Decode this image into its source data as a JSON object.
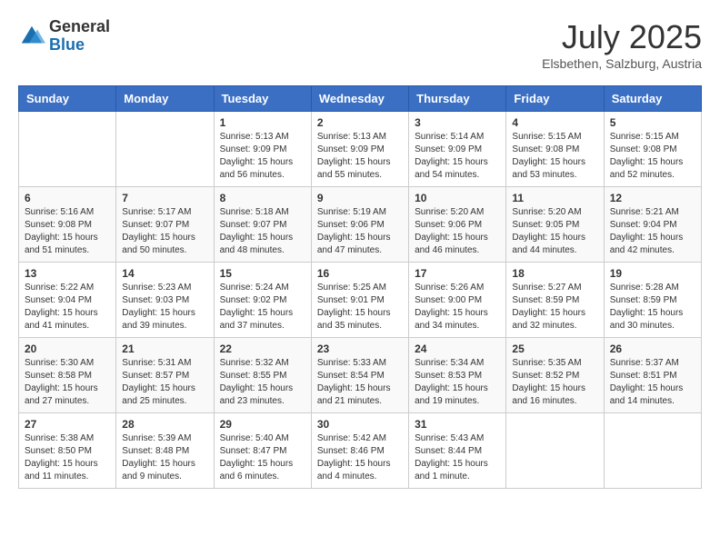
{
  "header": {
    "logo_general": "General",
    "logo_blue": "Blue",
    "month_title": "July 2025",
    "location": "Elsbethen, Salzburg, Austria"
  },
  "days_of_week": [
    "Sunday",
    "Monday",
    "Tuesday",
    "Wednesday",
    "Thursday",
    "Friday",
    "Saturday"
  ],
  "weeks": [
    [
      {
        "day": "",
        "sunrise": "",
        "sunset": "",
        "daylight": ""
      },
      {
        "day": "",
        "sunrise": "",
        "sunset": "",
        "daylight": ""
      },
      {
        "day": "1",
        "sunrise": "Sunrise: 5:13 AM",
        "sunset": "Sunset: 9:09 PM",
        "daylight": "Daylight: 15 hours and 56 minutes."
      },
      {
        "day": "2",
        "sunrise": "Sunrise: 5:13 AM",
        "sunset": "Sunset: 9:09 PM",
        "daylight": "Daylight: 15 hours and 55 minutes."
      },
      {
        "day": "3",
        "sunrise": "Sunrise: 5:14 AM",
        "sunset": "Sunset: 9:09 PM",
        "daylight": "Daylight: 15 hours and 54 minutes."
      },
      {
        "day": "4",
        "sunrise": "Sunrise: 5:15 AM",
        "sunset": "Sunset: 9:08 PM",
        "daylight": "Daylight: 15 hours and 53 minutes."
      },
      {
        "day": "5",
        "sunrise": "Sunrise: 5:15 AM",
        "sunset": "Sunset: 9:08 PM",
        "daylight": "Daylight: 15 hours and 52 minutes."
      }
    ],
    [
      {
        "day": "6",
        "sunrise": "Sunrise: 5:16 AM",
        "sunset": "Sunset: 9:08 PM",
        "daylight": "Daylight: 15 hours and 51 minutes."
      },
      {
        "day": "7",
        "sunrise": "Sunrise: 5:17 AM",
        "sunset": "Sunset: 9:07 PM",
        "daylight": "Daylight: 15 hours and 50 minutes."
      },
      {
        "day": "8",
        "sunrise": "Sunrise: 5:18 AM",
        "sunset": "Sunset: 9:07 PM",
        "daylight": "Daylight: 15 hours and 48 minutes."
      },
      {
        "day": "9",
        "sunrise": "Sunrise: 5:19 AM",
        "sunset": "Sunset: 9:06 PM",
        "daylight": "Daylight: 15 hours and 47 minutes."
      },
      {
        "day": "10",
        "sunrise": "Sunrise: 5:20 AM",
        "sunset": "Sunset: 9:06 PM",
        "daylight": "Daylight: 15 hours and 46 minutes."
      },
      {
        "day": "11",
        "sunrise": "Sunrise: 5:20 AM",
        "sunset": "Sunset: 9:05 PM",
        "daylight": "Daylight: 15 hours and 44 minutes."
      },
      {
        "day": "12",
        "sunrise": "Sunrise: 5:21 AM",
        "sunset": "Sunset: 9:04 PM",
        "daylight": "Daylight: 15 hours and 42 minutes."
      }
    ],
    [
      {
        "day": "13",
        "sunrise": "Sunrise: 5:22 AM",
        "sunset": "Sunset: 9:04 PM",
        "daylight": "Daylight: 15 hours and 41 minutes."
      },
      {
        "day": "14",
        "sunrise": "Sunrise: 5:23 AM",
        "sunset": "Sunset: 9:03 PM",
        "daylight": "Daylight: 15 hours and 39 minutes."
      },
      {
        "day": "15",
        "sunrise": "Sunrise: 5:24 AM",
        "sunset": "Sunset: 9:02 PM",
        "daylight": "Daylight: 15 hours and 37 minutes."
      },
      {
        "day": "16",
        "sunrise": "Sunrise: 5:25 AM",
        "sunset": "Sunset: 9:01 PM",
        "daylight": "Daylight: 15 hours and 35 minutes."
      },
      {
        "day": "17",
        "sunrise": "Sunrise: 5:26 AM",
        "sunset": "Sunset: 9:00 PM",
        "daylight": "Daylight: 15 hours and 34 minutes."
      },
      {
        "day": "18",
        "sunrise": "Sunrise: 5:27 AM",
        "sunset": "Sunset: 8:59 PM",
        "daylight": "Daylight: 15 hours and 32 minutes."
      },
      {
        "day": "19",
        "sunrise": "Sunrise: 5:28 AM",
        "sunset": "Sunset: 8:59 PM",
        "daylight": "Daylight: 15 hours and 30 minutes."
      }
    ],
    [
      {
        "day": "20",
        "sunrise": "Sunrise: 5:30 AM",
        "sunset": "Sunset: 8:58 PM",
        "daylight": "Daylight: 15 hours and 27 minutes."
      },
      {
        "day": "21",
        "sunrise": "Sunrise: 5:31 AM",
        "sunset": "Sunset: 8:57 PM",
        "daylight": "Daylight: 15 hours and 25 minutes."
      },
      {
        "day": "22",
        "sunrise": "Sunrise: 5:32 AM",
        "sunset": "Sunset: 8:55 PM",
        "daylight": "Daylight: 15 hours and 23 minutes."
      },
      {
        "day": "23",
        "sunrise": "Sunrise: 5:33 AM",
        "sunset": "Sunset: 8:54 PM",
        "daylight": "Daylight: 15 hours and 21 minutes."
      },
      {
        "day": "24",
        "sunrise": "Sunrise: 5:34 AM",
        "sunset": "Sunset: 8:53 PM",
        "daylight": "Daylight: 15 hours and 19 minutes."
      },
      {
        "day": "25",
        "sunrise": "Sunrise: 5:35 AM",
        "sunset": "Sunset: 8:52 PM",
        "daylight": "Daylight: 15 hours and 16 minutes."
      },
      {
        "day": "26",
        "sunrise": "Sunrise: 5:37 AM",
        "sunset": "Sunset: 8:51 PM",
        "daylight": "Daylight: 15 hours and 14 minutes."
      }
    ],
    [
      {
        "day": "27",
        "sunrise": "Sunrise: 5:38 AM",
        "sunset": "Sunset: 8:50 PM",
        "daylight": "Daylight: 15 hours and 11 minutes."
      },
      {
        "day": "28",
        "sunrise": "Sunrise: 5:39 AM",
        "sunset": "Sunset: 8:48 PM",
        "daylight": "Daylight: 15 hours and 9 minutes."
      },
      {
        "day": "29",
        "sunrise": "Sunrise: 5:40 AM",
        "sunset": "Sunset: 8:47 PM",
        "daylight": "Daylight: 15 hours and 6 minutes."
      },
      {
        "day": "30",
        "sunrise": "Sunrise: 5:42 AM",
        "sunset": "Sunset: 8:46 PM",
        "daylight": "Daylight: 15 hours and 4 minutes."
      },
      {
        "day": "31",
        "sunrise": "Sunrise: 5:43 AM",
        "sunset": "Sunset: 8:44 PM",
        "daylight": "Daylight: 15 hours and 1 minute."
      },
      {
        "day": "",
        "sunrise": "",
        "sunset": "",
        "daylight": ""
      },
      {
        "day": "",
        "sunrise": "",
        "sunset": "",
        "daylight": ""
      }
    ]
  ]
}
